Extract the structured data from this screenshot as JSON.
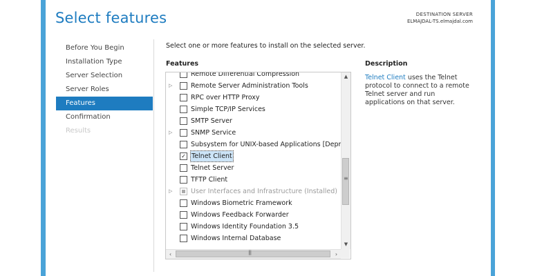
{
  "page": {
    "title": "Select features"
  },
  "destination": {
    "label": "DESTINATION SERVER",
    "server": "ELMAJDAL-TS.elmajdal.com"
  },
  "nav": {
    "items": [
      {
        "label": "Before You Begin",
        "state": "normal"
      },
      {
        "label": "Installation Type",
        "state": "normal"
      },
      {
        "label": "Server Selection",
        "state": "normal"
      },
      {
        "label": "Server Roles",
        "state": "normal"
      },
      {
        "label": "Features",
        "state": "active"
      },
      {
        "label": "Confirmation",
        "state": "normal"
      },
      {
        "label": "Results",
        "state": "disabled"
      }
    ]
  },
  "main": {
    "instruction": "Select one or more features to install on the selected server.",
    "features_label": "Features"
  },
  "features": [
    {
      "label": "Remote Differential Compression",
      "checked": false,
      "expandable": false
    },
    {
      "label": "Remote Server Administration Tools",
      "checked": false,
      "expandable": true
    },
    {
      "label": "RPC over HTTP Proxy",
      "checked": false,
      "expandable": false
    },
    {
      "label": "Simple TCP/IP Services",
      "checked": false,
      "expandable": false
    },
    {
      "label": "SMTP Server",
      "checked": false,
      "expandable": false
    },
    {
      "label": "SNMP Service",
      "checked": false,
      "expandable": true
    },
    {
      "label": "Subsystem for UNIX-based Applications [Deprecat",
      "checked": false,
      "expandable": false
    },
    {
      "label": "Telnet Client",
      "checked": true,
      "expandable": false,
      "selected": true
    },
    {
      "label": "Telnet Server",
      "checked": false,
      "expandable": false
    },
    {
      "label": "TFTP Client",
      "checked": false,
      "expandable": false
    },
    {
      "label": "User Interfaces and Infrastructure (Installed)",
      "checked": "partial",
      "expandable": true,
      "installed": true
    },
    {
      "label": "Windows Biometric Framework",
      "checked": false,
      "expandable": false
    },
    {
      "label": "Windows Feedback Forwarder",
      "checked": false,
      "expandable": false
    },
    {
      "label": "Windows Identity Foundation 3.5",
      "checked": false,
      "expandable": false
    },
    {
      "label": "Windows Internal Database",
      "checked": false,
      "expandable": false
    }
  ],
  "description": {
    "title": "Description",
    "link_text": "Telnet Client",
    "body": " uses the Telnet protocol to connect to a remote Telnet server and run applications on that server."
  },
  "icons": {
    "expand": "expand-arrow-icon",
    "check": "checkmark-icon",
    "scroll_up": "scroll-up-arrow-icon",
    "scroll_down": "scroll-down-arrow-icon",
    "scroll_left": "scroll-left-arrow-icon",
    "scroll_right": "scroll-right-arrow-icon"
  },
  "colors": {
    "accent": "#1e7cc0",
    "frame": "#4aa3d8",
    "selection": "#cce4f7"
  }
}
